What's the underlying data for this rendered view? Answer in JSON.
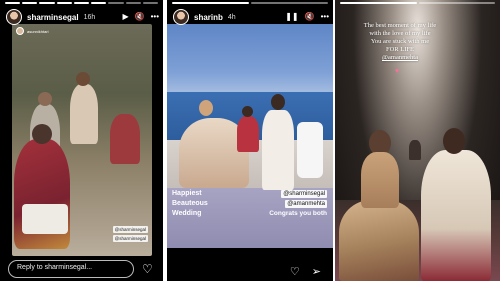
{
  "stories": [
    {
      "username": "sharminsegal",
      "time": "16h",
      "embedded_username": "asunnikhtari",
      "tags": [
        "@sharminsegal",
        "@sharminsegal"
      ],
      "reply_placeholder": "Reply to sharminsegal..."
    },
    {
      "username": "sharinb",
      "time": "4h",
      "caption_lines": [
        "Happiest",
        "Beauteous",
        "Wedding"
      ],
      "mentions": [
        "@sharminsegal",
        "@amanmehta"
      ],
      "congrats": "Congrats you both"
    },
    {
      "overlay_lines": [
        "The best moment of my life",
        "with the love of my life",
        "You are stuck with me",
        "FOR LIFE"
      ],
      "overlay_handle": "@amanmehta"
    }
  ],
  "colors": {
    "heart": "#ff6e9a",
    "sky": "#6b90c9",
    "lavender": "#9b98bb"
  },
  "icons": [
    "play-icon",
    "mute-icon",
    "more-icon",
    "pause-icon",
    "heart-icon",
    "send-icon"
  ]
}
